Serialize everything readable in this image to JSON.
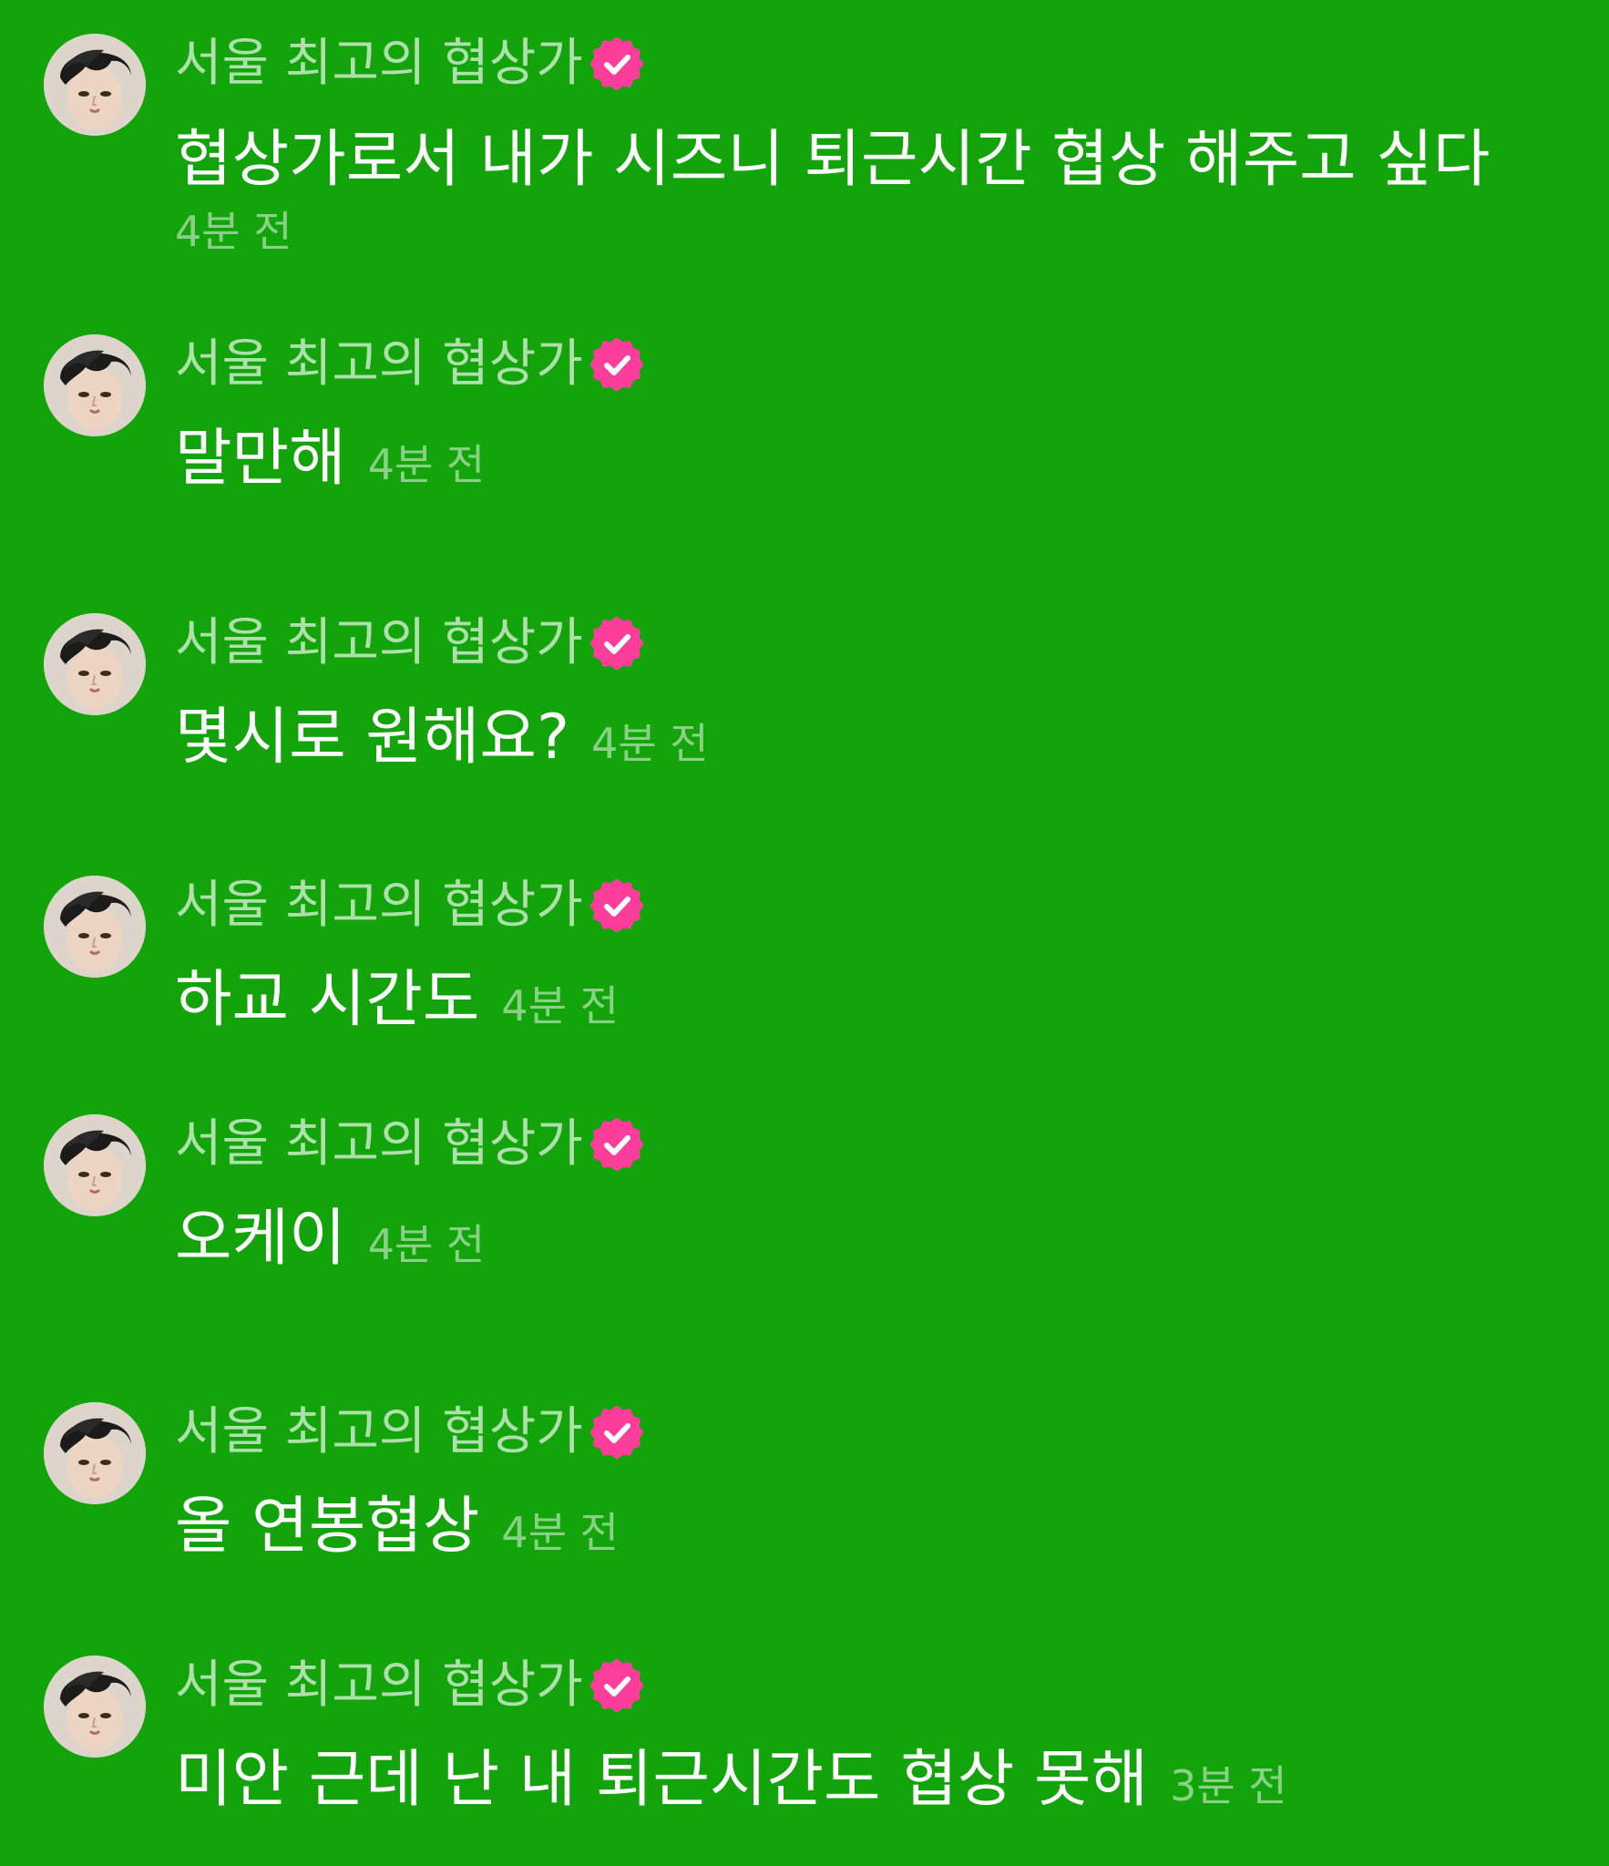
{
  "accent": {
    "background": "#12a40a",
    "verified_badge": "#ff3d9a"
  },
  "comments": [
    {
      "username": "서울 최고의 협상가",
      "message": "협상가로서 내가 시즈니 퇴근시간 협상 해주고 싶다",
      "time": "4분 전",
      "avatar_icon": "profile-photo",
      "badge_icon": "verified-badge-icon"
    },
    {
      "username": "서울 최고의 협상가",
      "message": "말만해",
      "time": "4분 전",
      "avatar_icon": "profile-photo",
      "badge_icon": "verified-badge-icon"
    },
    {
      "username": "서울 최고의 협상가",
      "message": "몇시로 원해요?",
      "time": "4분 전",
      "avatar_icon": "profile-photo",
      "badge_icon": "verified-badge-icon"
    },
    {
      "username": "서울 최고의 협상가",
      "message": "하교 시간도",
      "time": "4분 전",
      "avatar_icon": "profile-photo",
      "badge_icon": "verified-badge-icon"
    },
    {
      "username": "서울 최고의 협상가",
      "message": "오케이",
      "time": "4분 전",
      "avatar_icon": "profile-photo",
      "badge_icon": "verified-badge-icon"
    },
    {
      "username": "서울 최고의 협상가",
      "message": "올 연봉협상",
      "time": "4분 전",
      "avatar_icon": "profile-photo",
      "badge_icon": "verified-badge-icon"
    },
    {
      "username": "서울 최고의 협상가",
      "message": "미안 근데 난 내 퇴근시간도 협상 못해",
      "time": "3분 전",
      "avatar_icon": "profile-photo",
      "badge_icon": "verified-badge-icon"
    }
  ]
}
